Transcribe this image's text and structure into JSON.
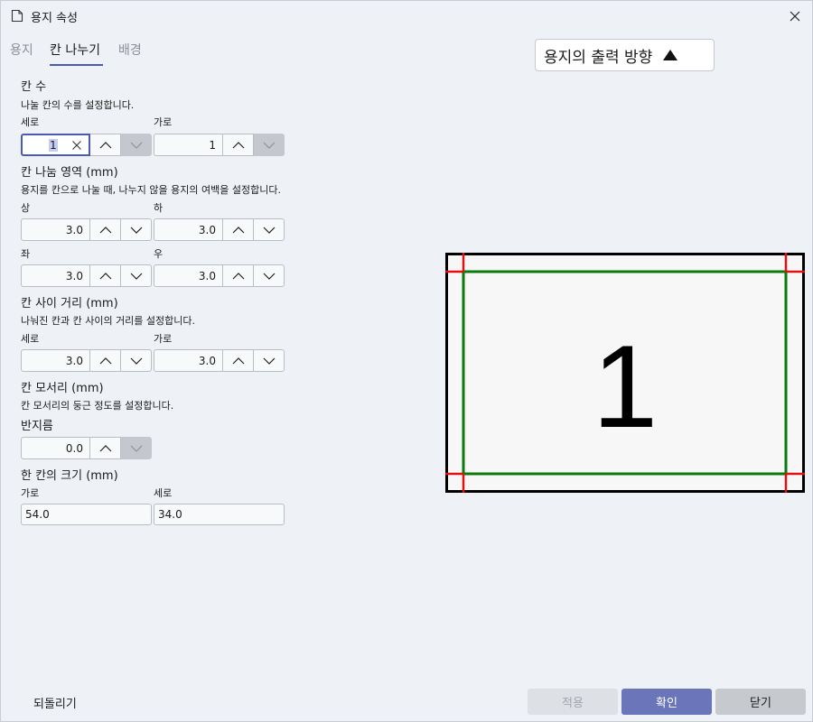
{
  "window": {
    "title": "용지 속성"
  },
  "tabs": [
    {
      "label": "용지"
    },
    {
      "label": "칸 나누기"
    },
    {
      "label": "배경"
    }
  ],
  "orientation": {
    "label": "용지의 출력 방향"
  },
  "count": {
    "title": "칸 수",
    "desc": "나눌 칸의 수를 설정합니다.",
    "rows_label": "세로",
    "rows_value": "1",
    "cols_label": "가로",
    "cols_value": "1"
  },
  "margin": {
    "title": "칸 나눔 영역 (mm)",
    "desc": "용지를 칸으로 나눌 때, 나누지 않을 용지의 여백을 설정합니다.",
    "top_label": "상",
    "top_value": "3.0",
    "bottom_label": "하",
    "bottom_value": "3.0",
    "left_label": "좌",
    "left_value": "3.0",
    "right_label": "우",
    "right_value": "3.0"
  },
  "gap": {
    "title": "칸 사이 거리 (mm)",
    "desc": "나눠진 칸과 칸 사이의 거리를 설정합니다.",
    "v_label": "세로",
    "v_value": "3.0",
    "h_label": "가로",
    "h_value": "3.0"
  },
  "corner": {
    "title": "칸 모서리 (mm)",
    "desc": "칸 모서리의 둥근 정도를 설정합니다.",
    "radius_label": "반지름",
    "radius_value": "0.0"
  },
  "cellsize": {
    "title": "한 칸의 크기 (mm)",
    "w_label": "가로",
    "w_value": "54.0",
    "h_label": "세로",
    "h_value": "34.0"
  },
  "preview": {
    "cell_number": "1"
  },
  "footer": {
    "reset_label": "되돌리기",
    "apply_label": "적용",
    "ok_label": "확인",
    "close_label": "닫기"
  },
  "colors": {
    "accent": "#4a5bb5",
    "ok_button": "#6a76b9",
    "preview_cell_border": "#0a7a0a",
    "preview_margin_lines": "#e01010"
  },
  "icons": {
    "title": "document-icon",
    "close": "close-icon",
    "orientation": "triangle-up-icon",
    "spin_up": "chevron-up-icon",
    "spin_down": "chevron-down-icon",
    "clear": "clear-x-icon"
  }
}
